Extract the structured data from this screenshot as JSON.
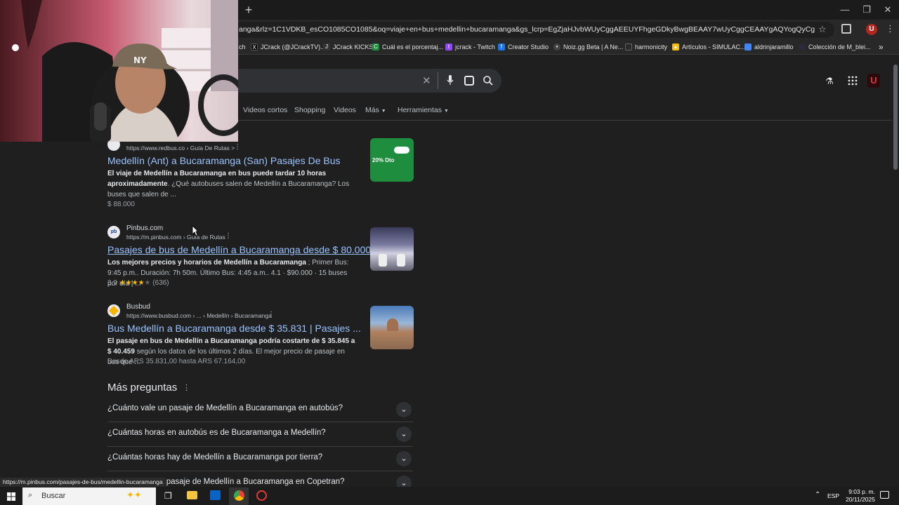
{
  "browser": {
    "url": "anga&rlz=1C1VDKB_esCO1085CO1085&oq=viaje+en+bus+medellin+bucaramanga&gs_lcrp=EgZjaHJvbWUyCggAEEUYFhgeGDkyBwgBEAAY7wUyCggCEAAYgAQYogQyCggDEAAYgAQYogTSAQkxM...",
    "bookmarks": [
      "ch",
      "JCrack (@JCrackTV)...",
      "JCrack KICKS",
      "Cuál es el porcentaj...",
      "jcrack - Twitch",
      "Creator Studio",
      "Noiz.gg Beta | A Ne...",
      "harmonicity",
      "Artículos - SIMULAC...",
      "aldrinjaramillo",
      "Colección de M_blei..."
    ],
    "more_bookmarks": "»"
  },
  "google": {
    "tabs": [
      "Videos cortos",
      "Shopping",
      "Videos",
      "Más",
      "Herramientas"
    ]
  },
  "results": [
    {
      "site": "",
      "url": "https://www.redbus.co › Guía De Rutas >",
      "title": "Medellín (Ant) a Bucaramanga (San) Pasajes De Bus",
      "snippet_bold": "El viaje de Medellín a Bucaramanga en bus puede tardar 10 horas aproximadamente",
      "snippet_rest": ". ¿Qué autobuses salen de Medellín a Bucaramanga? Los buses que salen de ...",
      "meta": "$ 88.000",
      "thumb_text": "20% Dto"
    },
    {
      "site": "Pinbus.com",
      "url": "https://m.pinbus.com › Guía de Rutas",
      "title": "Pasajes de bus de Medellín a Bucaramanga desde $ 80.000",
      "snippet_bold": "Los mejores precios y horarios de Medellín a Bucaramanga",
      "snippet_rest": " ; Primer Bus: 9:45 p.m.. Duración: 7h 50m. Último Bus: 4:45 a.m.. 4.1 · $90.000 · 15 buses por día | ...",
      "rating": "3,9",
      "rating_count": "(636)"
    },
    {
      "site": "Busbud",
      "url": "https://www.busbud.com › ... › Medellín › Bucaramanga",
      "title": "Bus Medellín a Bucaramanga desde $ 35.831 | Pasajes ...",
      "snippet_bold": "El pasaje en bus de Medellín a Bucaramanga podría costarte de $ 35.845 a $ 40.459",
      "snippet_rest": " según los datos de los últimos 2 días. El mejor precio de pasaje en bus que ...",
      "meta": "Desde ARS 35.831,00 hasta ARS 67.164,00"
    }
  ],
  "faq": {
    "heading": "Más preguntas",
    "questions": [
      "¿Cuánto vale un pasaje de Medellín a Bucaramanga en autobús?",
      "¿Cuántas horas en autobús es de Bucaramanga a Medellín?",
      "¿Cuántas horas hay de Medellín a Bucaramanga por tierra?",
      "¿Cuánto vale el pasaje de Medellín a Bucaramanga en Copetran?"
    ]
  },
  "status_url": "https://m.pinbus.com/pasajes-de-bus/medellin-bucaramanga",
  "taskbar": {
    "search_placeholder": "Buscar",
    "language": "ESP",
    "time": "9:03 p. m.",
    "date": "20/11/2025"
  },
  "colors": {
    "link": "#99c3ff",
    "background": "#1f1f1f"
  }
}
